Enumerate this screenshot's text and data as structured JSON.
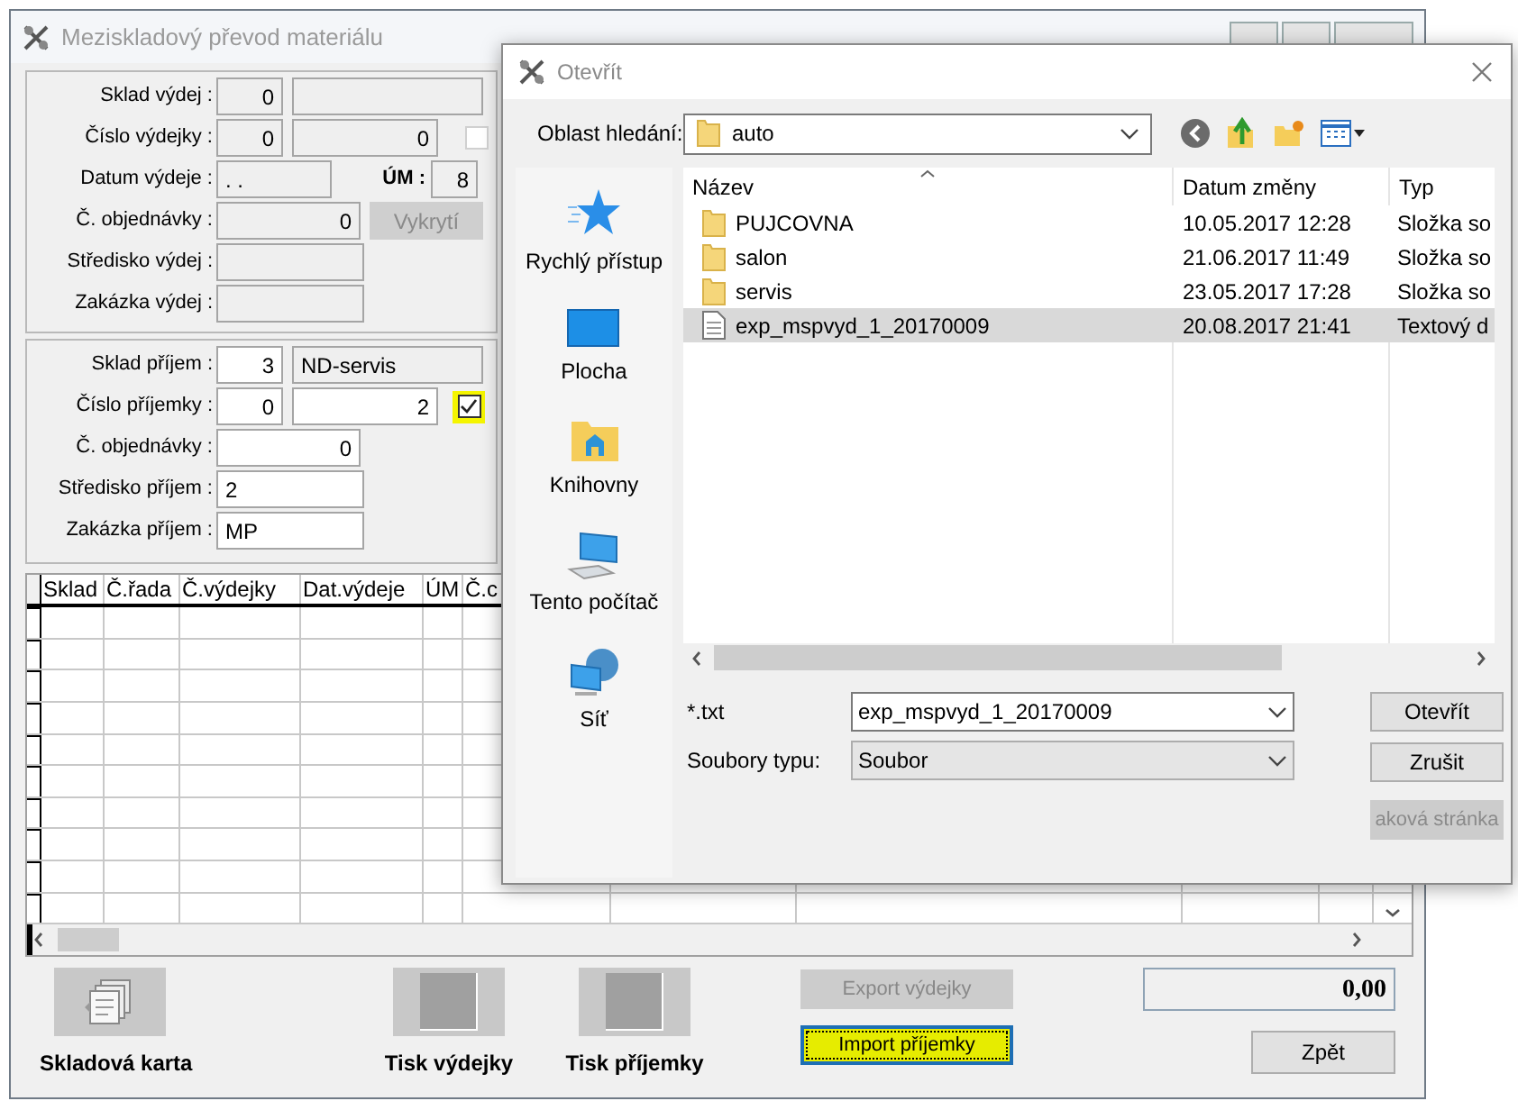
{
  "main_window": {
    "title": "Meziskladový převod materiálu"
  },
  "issue_panel": {
    "editable": false,
    "rows": [
      {
        "kind": "code_name",
        "label": "Sklad výdej :",
        "code": "0"
      },
      {
        "kind": "code_number_check",
        "label": "Číslo výdejky :",
        "code": "0",
        "number": "0",
        "checked": false,
        "highlighted": false
      },
      {
        "kind": "date_um",
        "label": "Datum výdeje :",
        "value": ". .",
        "um_label": "ÚM :",
        "um": "8"
      },
      {
        "kind": "order",
        "label": "Č. objednávky :",
        "value": "0",
        "button": {
          "label": "Vykrytí",
          "disabled": true
        }
      },
      {
        "kind": "text",
        "label": "Středisko výdej :"
      },
      {
        "kind": "text",
        "label": "Zakázka výdej :"
      }
    ]
  },
  "receipt_panel": {
    "editable": true,
    "rows": [
      {
        "kind": "code_name",
        "label": "Sklad příjem :",
        "code": "3",
        "name": "ND-servis"
      },
      {
        "kind": "code_number_check",
        "label": "Číslo příjemky :",
        "code": "0",
        "number": "2",
        "checked": true,
        "highlighted": true
      },
      {
        "kind": "order",
        "label": "Č. objednávky :",
        "value": "0"
      },
      {
        "kind": "text",
        "label": "Středisko příjem :",
        "value": "2"
      },
      {
        "kind": "text",
        "label": "Zakázka příjem :",
        "value": "MP"
      }
    ]
  },
  "grid": {
    "columns": [
      "Sklad",
      "Č.řada",
      "Č.výdejky",
      "Dat.výdeje",
      "ÚM",
      "Č.c"
    ]
  },
  "bottom": {
    "card_button": "Skladová karta",
    "print_issue": "Tisk výdejky",
    "print_receipt": "Tisk příjemky",
    "export_button": {
      "label": "Export výdejky",
      "disabled": true
    },
    "import_button": {
      "label": "Import příjemky",
      "disabled": false,
      "focused": true,
      "highlighted": true
    },
    "total": "0,00",
    "back_button": "Zpět"
  },
  "open_dialog": {
    "title": "Otevřít",
    "look_in_label": "Oblast hledání:",
    "look_in": "auto",
    "places": [
      {
        "kind": "star",
        "label": "Rychlý přístup"
      },
      {
        "kind": "desktop",
        "label": "Plocha"
      },
      {
        "kind": "library",
        "label": "Knihovny"
      },
      {
        "kind": "computer",
        "label": "Tento počítač"
      },
      {
        "kind": "network",
        "label": "Síť"
      }
    ],
    "columns": [
      "Název",
      "Datum změny",
      "Typ"
    ],
    "files": [
      {
        "kind": "folder",
        "name": "PUJCOVNA",
        "date": "10.05.2017 12:28",
        "type": "Složka so",
        "selected": false
      },
      {
        "kind": "folder",
        "name": "salon",
        "date": "21.06.2017 11:49",
        "type": "Složka so",
        "selected": false
      },
      {
        "kind": "folder",
        "name": "servis",
        "date": "23.05.2017 17:28",
        "type": "Složka so",
        "selected": false
      },
      {
        "kind": "file",
        "name": "exp_mspvyd_1_20170009",
        "date": "20.08.2017 21:41",
        "type": "Textový d",
        "selected": true
      }
    ],
    "file_name_label": "*.txt",
    "file_name": "exp_mspvyd_1_20170009",
    "file_type_label": "Soubory typu:",
    "file_type": "Soubor",
    "buttons": [
      {
        "label": "Otevřít",
        "disabled": false
      },
      {
        "label": "Zrušit",
        "disabled": false
      },
      {
        "label": "aková stránka",
        "disabled": true
      }
    ]
  }
}
